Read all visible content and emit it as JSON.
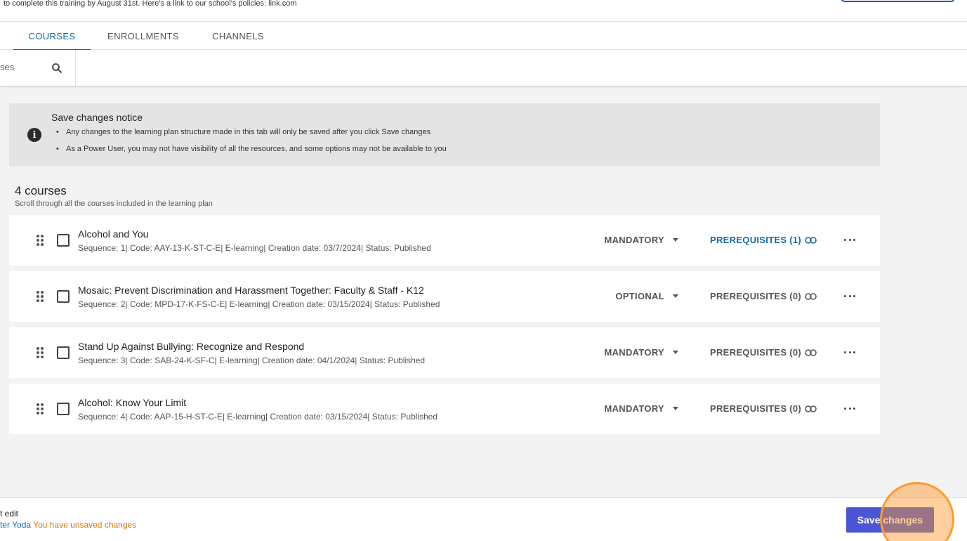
{
  "header": {
    "description": "to complete this training by August 31st.  Here's a link to our school's policies: link.com"
  },
  "tabs": [
    {
      "label": "COURSES"
    },
    {
      "label": "ENROLLMENTS"
    },
    {
      "label": "CHANNELS"
    }
  ],
  "search": {
    "placeholder": "ses"
  },
  "notice": {
    "title": "Save changes notice",
    "lines": [
      "Any changes to the learning plan structure made in this tab will only be saved after you click Save changes",
      "As a Power User, you may not have visibility of all the resources, and some options may not be available to you"
    ]
  },
  "courses_section": {
    "title": "4 courses",
    "subtitle": "Scroll through all the courses included in the learning plan"
  },
  "courses": [
    {
      "title": "Alcohol and You",
      "meta": "Sequence: 1| Code: AAY-13-K-ST-C-E| E-learning| Creation date: 03/7/2024| Status: Published",
      "requirement": "MANDATORY",
      "prerequisites": "PREREQUISITES (1)"
    },
    {
      "title": "Mosaic: Prevent Discrimination and Harassment Together: Faculty & Staff - K12",
      "meta": "Sequence: 2| Code: MPD-17-K-FS-C-E| E-learning| Creation date: 03/15/2024| Status: Published",
      "requirement": "OPTIONAL",
      "prerequisites": "PREREQUISITES (0)"
    },
    {
      "title": "Stand Up Against Bullying: Recognize and Respond",
      "meta": "Sequence: 3| Code: SAB-24-K-SF-C| E-learning| Creation date: 04/1/2024| Status: Published",
      "requirement": "MANDATORY",
      "prerequisites": "PREREQUISITES (0)"
    },
    {
      "title": "Alcohol: Know Your Limit",
      "meta": "Sequence: 4| Code: AAP-15-H-ST-C-E| E-learning| Creation date: 03/15/2024| Status: Published",
      "requirement": "MANDATORY",
      "prerequisites": "PREREQUISITES (0)"
    }
  ],
  "footer": {
    "line1": "t edit",
    "editor": "ter Yoda",
    "unsaved": "You have unsaved changes",
    "save_label": "Save changes"
  },
  "colors": {
    "accent": "#0f6a95",
    "save_button": "#4a56d4",
    "unsaved_text": "#d9730d",
    "highlight": "#ff9a2e"
  }
}
